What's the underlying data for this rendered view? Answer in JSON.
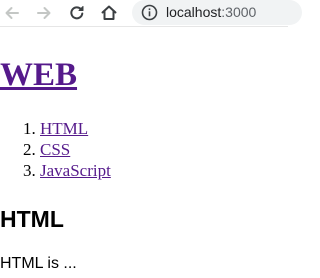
{
  "browser": {
    "url_host": "localhost",
    "url_port": ":3000",
    "icons": {
      "back": "back-arrow-icon",
      "forward": "forward-arrow-icon",
      "reload": "reload-icon",
      "home": "home-icon",
      "site_info": "info-icon"
    }
  },
  "page": {
    "title": "WEB",
    "topics": [
      {
        "label": "HTML"
      },
      {
        "label": "CSS"
      },
      {
        "label": "JavaScript"
      }
    ],
    "section_heading": "HTML",
    "section_body": "HTML is ..."
  },
  "colors": {
    "visited_link": "#551a8b",
    "omnibox_bg": "#f1f3f4",
    "icon_dark": "#5f6368",
    "icon_disabled": "#c4c7c5"
  }
}
